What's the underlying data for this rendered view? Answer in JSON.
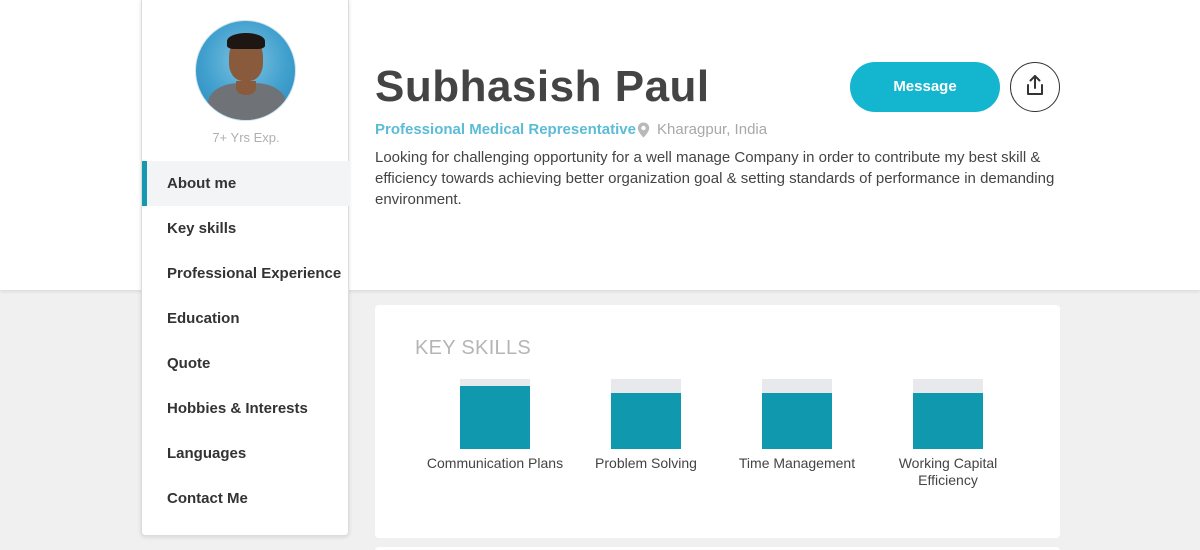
{
  "profile": {
    "experience": "7+ Yrs Exp.",
    "name": "Subhasish Paul",
    "role": "Professional Medical Representative",
    "location": "Kharagpur, India",
    "about": "Looking for challenging opportunity for a well manage Company in order to contribute my best skill & efficiency towards achieving better organization goal & setting standards of performance in demanding environment."
  },
  "actions": {
    "message_label": "Message",
    "share_icon": "share-upload-icon"
  },
  "sidebar": {
    "items": [
      {
        "label": "About me",
        "active": true
      },
      {
        "label": "Key skills",
        "active": false
      },
      {
        "label": "Professional Experience",
        "active": false
      },
      {
        "label": "Education",
        "active": false
      },
      {
        "label": "Quote",
        "active": false
      },
      {
        "label": "Hobbies & Interests",
        "active": false
      },
      {
        "label": "Languages",
        "active": false
      },
      {
        "label": "Contact Me",
        "active": false
      }
    ]
  },
  "skills": {
    "title": "KEY SKILLS",
    "items": [
      {
        "label": "Communication Plans",
        "level": 0.9
      },
      {
        "label": "Problem Solving",
        "level": 0.8
      },
      {
        "label": "Time Management",
        "level": 0.8
      },
      {
        "label": "Working Capital Efficiency",
        "level": 0.8
      }
    ]
  },
  "colors": {
    "accent": "#14b5cf",
    "active_border": "#1598b0",
    "skill_fill": "#1098af",
    "role_text": "#5bbcd6"
  }
}
